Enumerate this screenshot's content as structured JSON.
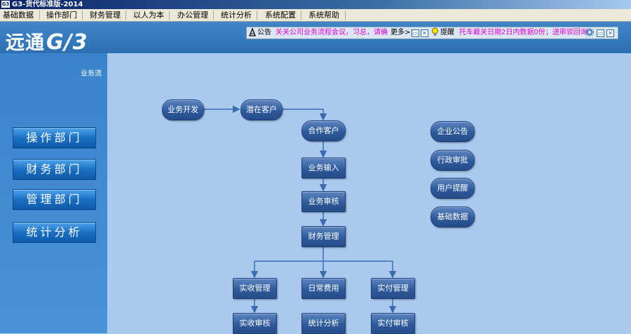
{
  "window": {
    "title": "G3-货代标准版-2014",
    "app_icon": "G3"
  },
  "menu": [
    "基础数据",
    "操作部门",
    "财务管理",
    "以人为本",
    "办公管理",
    "统计分析",
    "系统配置",
    "系统帮助"
  ],
  "brand": {
    "name": "远通",
    "mark": "G/3"
  },
  "notices": {
    "announcement_label": "公告",
    "announcement_text": "关关公司业务流程会议，习总，请确",
    "more_label": "更多>>",
    "reminder_label": "提醒",
    "reminder_text": "托车截关日期2日内数据0份；送审驳回询"
  },
  "sidebar": {
    "breadcrumb": "业务流",
    "buttons": [
      "操作部门",
      "财务部门",
      "管理部门",
      "统计分析"
    ]
  },
  "flow": {
    "business_dev": "业务开发",
    "potential_customer": "潜在客户",
    "partner_customer": "合作客户",
    "business_input": "业务输入",
    "business_review": "业务审核",
    "finance_mgmt": "财务管理",
    "receivable_mgmt": "实收管理",
    "daily_expense": "日常费用",
    "payable_mgmt": "实付管理",
    "receivable_review": "实收审核",
    "statistics": "统计分析",
    "payable_review": "实付审核"
  },
  "quick_links": [
    "企业公告",
    "行政审批",
    "用户提醒",
    "基础数据"
  ],
  "colors": {
    "banner": "#2c70b3",
    "workspace": "#a9c9ee",
    "node": "#2e5a9c",
    "notice_text": "#e000e0"
  }
}
